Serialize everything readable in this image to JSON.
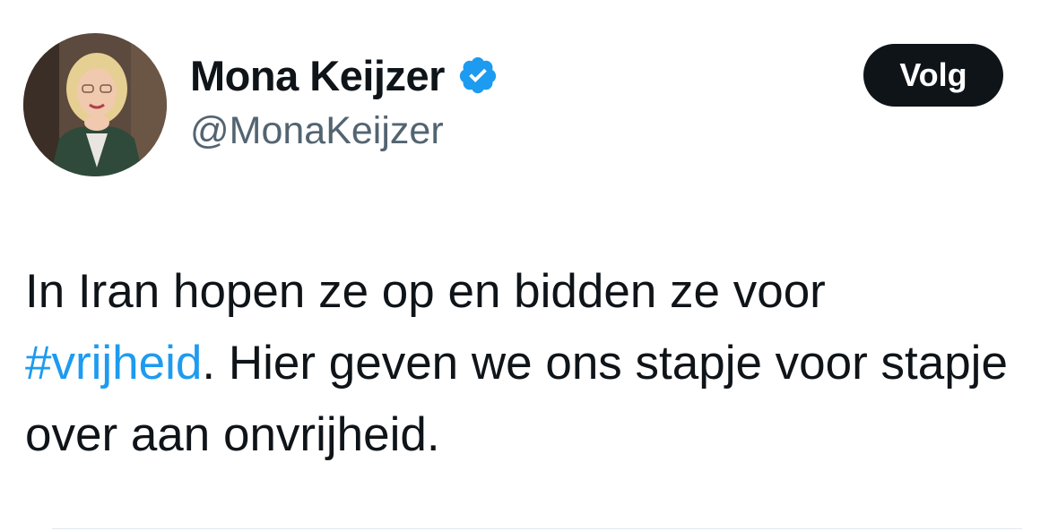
{
  "author": {
    "display_name": "Mona Keijzer",
    "handle": "@MonaKeijzer",
    "verified_icon": "verified-badge-icon",
    "verified_color": "#1d9bf0"
  },
  "follow_button": {
    "label": "Volg"
  },
  "tweet": {
    "text_before": "In Iran hopen ze op en bidden ze voor ",
    "hashtag": "#vrijheid",
    "text_after": ". Hier geven we ons stapje voor stapje over aan onvrijheid.",
    "hashtag_color": "#1d9bf0"
  }
}
